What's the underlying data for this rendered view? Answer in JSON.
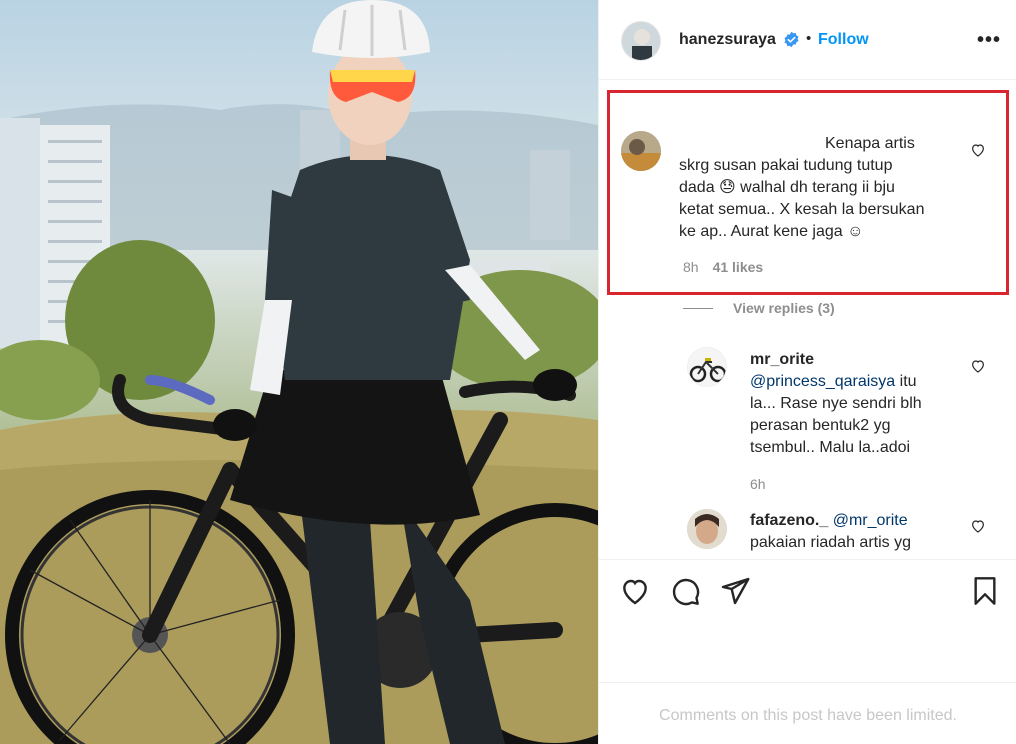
{
  "post": {
    "author": "hanezsuraya",
    "follow_label": "Follow",
    "separator": "•"
  },
  "comments": [
    {
      "username": "",
      "text_line1": "Kenapa artis",
      "text_line2": "skrg susan pakai tudung tutup",
      "text_line3": "dada 😓 walhal dh terang ii bju",
      "text_line4": "ketat semua.. X kesah la bersukan",
      "text_line5": "ke ap.. Aurat kene jaga ☺",
      "time": "8h",
      "likes": "41 likes"
    }
  ],
  "view_replies": "View replies (3)",
  "replies": [
    {
      "username": "mr_orite",
      "mention": "@princess_qaraisya",
      "text_line1_rest": "itu",
      "text_line2": "la... Rase nye sendri blh",
      "text_line3": "perasan bentuk2 yg",
      "text_line4": "tsembul.. Malu la..adoi",
      "time": "6h"
    },
    {
      "username": "fafazeno._",
      "mention": "@mr_orite",
      "text_line2": "pakaian riadah artis yg"
    }
  ],
  "limited_notice": "Comments on this post have been limited.",
  "icons": {
    "like": "heart-icon",
    "comment": "comment-icon",
    "share": "paper-plane-icon",
    "save": "bookmark-icon",
    "more": "more-options-icon",
    "verified": "verified-badge-icon"
  },
  "colors": {
    "accent": "#0095f6",
    "highlight_box": "#d7262f",
    "meta_text": "#8e8e8e",
    "mention": "#00376b"
  }
}
